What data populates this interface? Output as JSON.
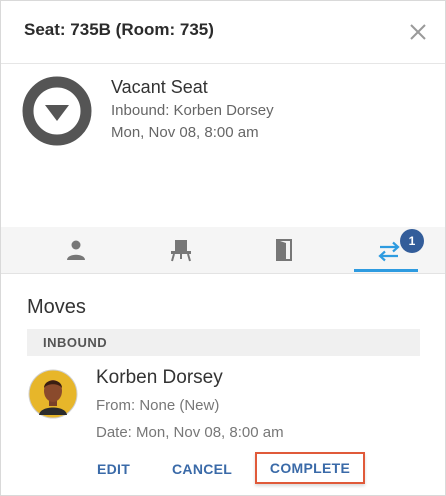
{
  "header": {
    "title": "Seat: 735B (Room: 735)"
  },
  "seat_info": {
    "status": "Vacant Seat",
    "inbound": "Inbound: Korben Dorsey",
    "datetime": "Mon, Nov 08, 8:00 am"
  },
  "tabs": [
    {
      "name": "person-icon"
    },
    {
      "name": "seat-icon"
    },
    {
      "name": "door-icon"
    },
    {
      "name": "moves-icon",
      "badge": "1",
      "active": true
    }
  ],
  "moves": {
    "title": "Moves",
    "section_label": "INBOUND",
    "person": {
      "name": "Korben Dorsey",
      "from": "From: None (New)",
      "date": "Date: Mon, Nov 08, 8:00 am"
    },
    "actions": {
      "edit": "EDIT",
      "cancel": "CANCEL",
      "complete": "COMPLETE"
    }
  },
  "colors": {
    "accent": "#2e9be0",
    "badge": "#335d9a",
    "action": "#3a6aa8",
    "highlight": "#e05a3a"
  }
}
